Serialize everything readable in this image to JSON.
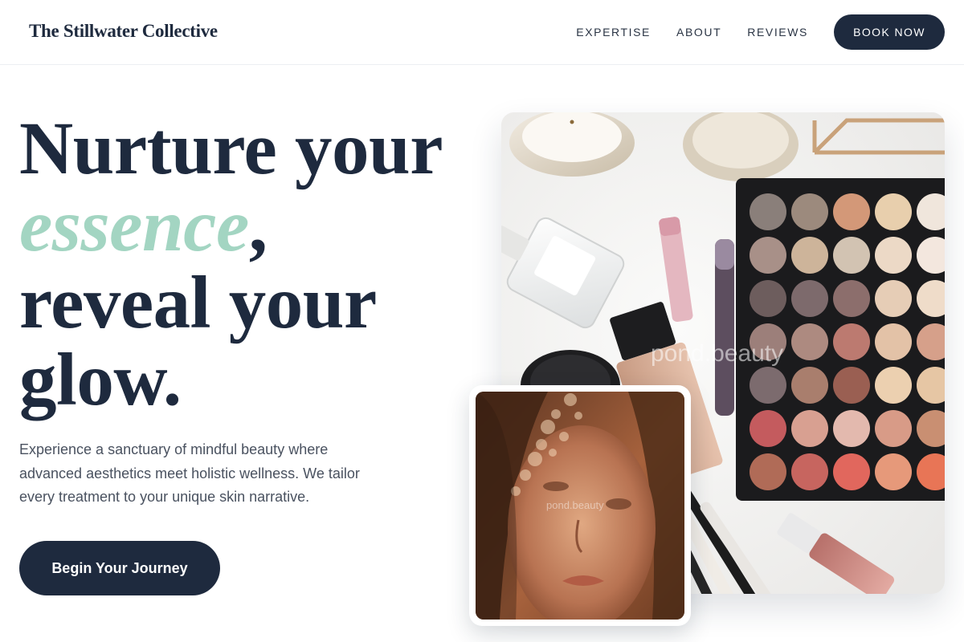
{
  "header": {
    "brand": "The Stillwater Collective",
    "nav": [
      {
        "label": "EXPERTISE"
      },
      {
        "label": "ABOUT"
      },
      {
        "label": "REVIEWS"
      }
    ],
    "cta_label": "BOOK NOW"
  },
  "hero": {
    "headline": {
      "line1": "Nurture your",
      "accent": "essence",
      "comma": ",",
      "line3": "reveal your",
      "line4": "glow."
    },
    "subtext": "Experience a sanctuary of mindful beauty where advanced aesthetics meet holistic wellness. We tailor every treatment to your unique skin narrative.",
    "cta_label": "Begin Your Journey"
  },
  "images": {
    "main_watermark": "pond.beauty",
    "portrait_watermark": "pond.beauty"
  },
  "colors": {
    "navy": "#1e2a3e",
    "accent_mint": "#a3d5c2",
    "body_text": "#4a5260"
  }
}
